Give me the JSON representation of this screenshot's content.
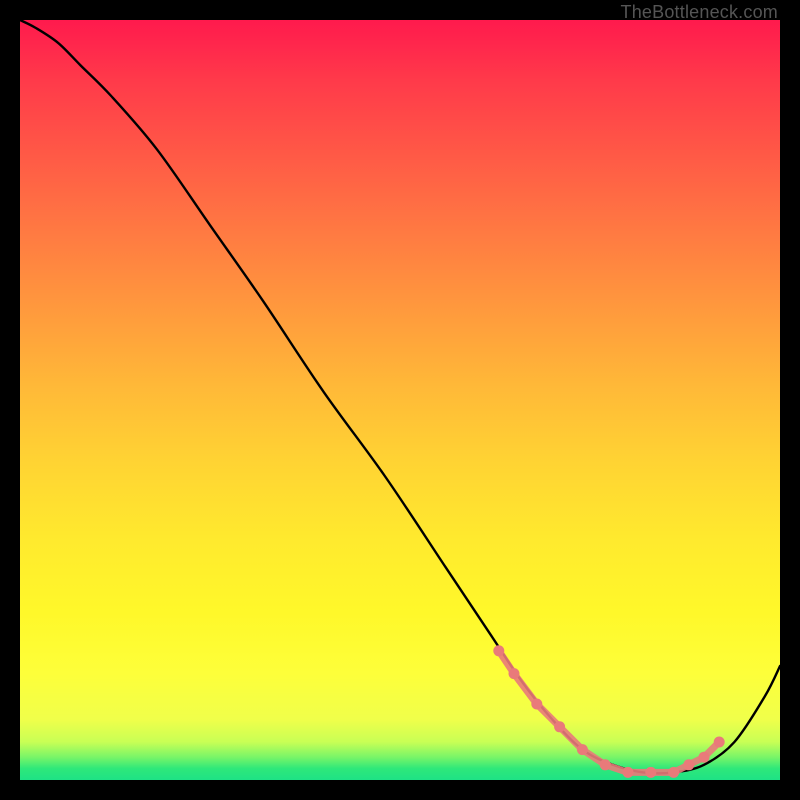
{
  "attribution": "TheBottleneck.com",
  "chart_data": {
    "type": "line",
    "title": "",
    "xlabel": "",
    "ylabel": "",
    "xlim": [
      0,
      100
    ],
    "ylim": [
      0,
      100
    ],
    "grid": false,
    "series": [
      {
        "name": "curve",
        "color": "#000000",
        "x": [
          0,
          2,
          5,
          8,
          12,
          18,
          25,
          32,
          40,
          48,
          56,
          62,
          66,
          70,
          74,
          78,
          82,
          86,
          90,
          94,
          98,
          100
        ],
        "values": [
          100,
          99,
          97,
          94,
          90,
          83,
          73,
          63,
          51,
          40,
          28,
          19,
          13,
          8,
          4,
          2,
          1,
          1,
          2,
          5,
          11,
          15
        ]
      },
      {
        "name": "highlight-dots",
        "color": "#e97a7a",
        "type": "scatter",
        "x": [
          63,
          65,
          68,
          71,
          74,
          77,
          80,
          83,
          86,
          88,
          90,
          92
        ],
        "values": [
          17,
          14,
          10,
          7,
          4,
          2,
          1,
          1,
          1,
          2,
          3,
          5
        ]
      }
    ],
    "background_gradient": {
      "stops": [
        {
          "pos": 0.0,
          "color": "#ff1a4d"
        },
        {
          "pos": 0.38,
          "color": "#ff993d"
        },
        {
          "pos": 0.68,
          "color": "#ffe92e"
        },
        {
          "pos": 0.92,
          "color": "#f0ff4a"
        },
        {
          "pos": 0.98,
          "color": "#2ee87a"
        },
        {
          "pos": 1.0,
          "color": "#1ee285"
        }
      ]
    }
  }
}
